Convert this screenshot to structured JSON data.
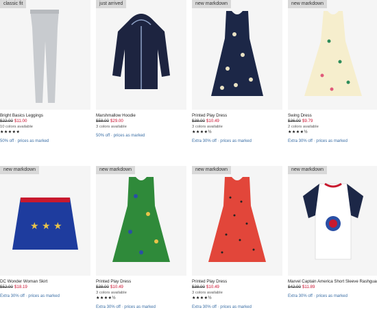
{
  "products": [
    {
      "badge": "classic fit",
      "name": "Bright Basics Leggings",
      "old_price": "$22.00",
      "new_price": "$11.00",
      "colors": "10 colors available",
      "rating": "★★★★★",
      "promo": "50% off · prices as marked"
    },
    {
      "badge": "just arrived",
      "name": "Marshmallow Hoodie",
      "old_price": "$58.00",
      "new_price": "$29.00",
      "colors": "3 colors available",
      "rating": "",
      "promo": "50% off · prices as marked"
    },
    {
      "badge": "new markdown",
      "name": "Printed Play Dress",
      "old_price": "$38.00",
      "new_price": "$10.49",
      "colors": "3 colors available",
      "rating": "★★★★½",
      "promo": "Extra 30% off · prices as marked"
    },
    {
      "badge": "new markdown",
      "name": "Swing Dress",
      "old_price": "$36.00",
      "new_price": "$9.79",
      "colors": "2 colors available",
      "rating": "★★★★½",
      "promo": "Extra 30% off · prices as marked"
    },
    {
      "badge": "new markdown",
      "name": "DC Wonder Woman Skirt",
      "old_price": "$52.00",
      "new_price": "$18.19",
      "colors": "",
      "rating": "",
      "promo": "Extra 30% off · prices as marked"
    },
    {
      "badge": "new markdown",
      "name": "Printed Play Dress",
      "old_price": "$38.00",
      "new_price": "$10.49",
      "colors": "3 colors available",
      "rating": "★★★★½",
      "promo": "Extra 30% off · prices as marked"
    },
    {
      "badge": "new markdown",
      "name": "Printed Play Dress",
      "old_price": "$38.00",
      "new_price": "$10.49",
      "colors": "3 colors available",
      "rating": "★★★★½",
      "promo": "Extra 30% off · prices as marked"
    },
    {
      "badge": "new markdown",
      "name": "Marvel Captain America Short Sleeve Rashguard",
      "old_price": "$42.00",
      "new_price": "$11.89",
      "colors": "",
      "rating": "",
      "promo": "Extra 30% off · prices as marked"
    }
  ]
}
